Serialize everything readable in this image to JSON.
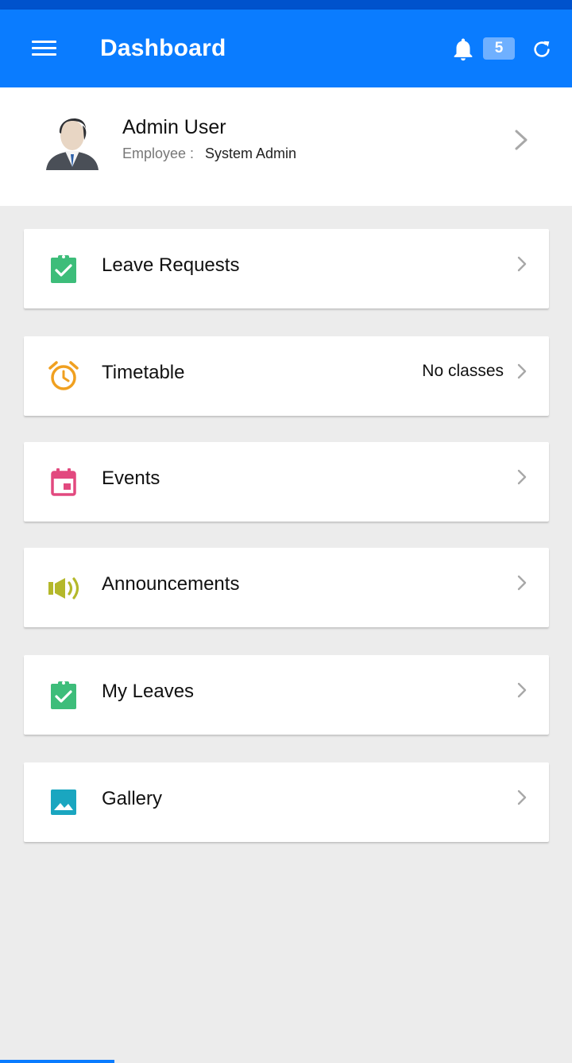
{
  "app_bar": {
    "title": "Dashboard",
    "notification_count": "5",
    "background_color": "#0a7cff",
    "icons": [
      "menu-icon",
      "bell-icon",
      "refresh-icon"
    ]
  },
  "profile": {
    "name": "Admin User",
    "role_label": "Employee :",
    "role_value": "System Admin"
  },
  "menu_items": [
    {
      "label": "Leave Requests",
      "value": "",
      "icon": "clipboard-check-icon",
      "color": "#3dbd7a"
    },
    {
      "label": "Timetable",
      "value": "No classes",
      "icon": "alarm-clock-icon",
      "color": "#f0a020"
    },
    {
      "label": "Events",
      "value": "",
      "icon": "calendar-icon",
      "color": "#e2497f"
    },
    {
      "label": "Announcements",
      "value": "",
      "icon": "megaphone-icon",
      "color": "#b4b82a"
    },
    {
      "label": "My Leaves",
      "value": "",
      "icon": "clipboard-check-icon",
      "color": "#3dbd7a"
    },
    {
      "label": "Gallery",
      "value": "",
      "icon": "image-icon",
      "color": "#1aa6c0"
    }
  ]
}
